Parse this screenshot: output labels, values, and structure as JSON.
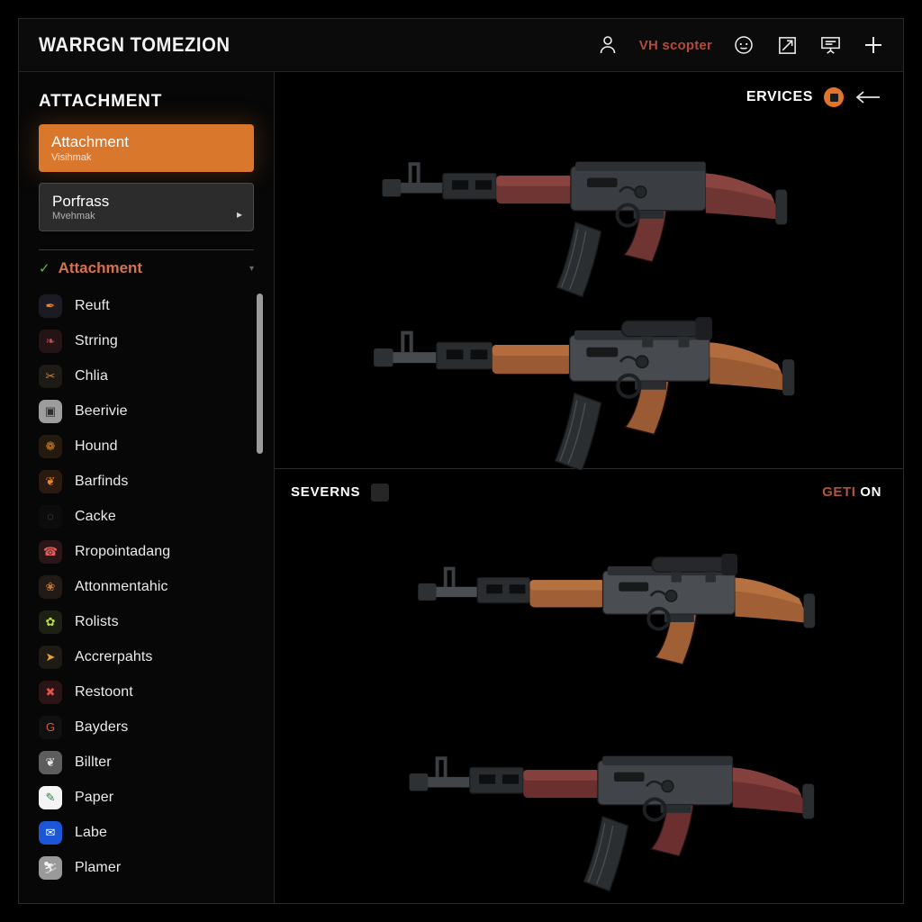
{
  "header": {
    "title": "WARRGN TOMEZION",
    "user_icon": "person-icon",
    "user_tag": "VH scopter",
    "more_icon": "circle-dots-icon",
    "expand_icon": "arrow-expand-icon",
    "board_icon": "presentation-board-icon",
    "add_icon": "plus-icon"
  },
  "sidebar": {
    "title": "ATTACHMENT",
    "primary_card": {
      "title": "Attachment",
      "subtitle": "Visihmak"
    },
    "secondary_card": {
      "title": "Porfrass",
      "subtitle": "Mvehmak",
      "chevron": "▸"
    },
    "section": {
      "check": "✓",
      "label": "Attachment",
      "caret": "▾"
    },
    "items": [
      {
        "label": "Plamer",
        "icon": "plamer-icon",
        "bg": "#9a9a9a",
        "fg": "#f2f2f2",
        "glyph": "⛷"
      },
      {
        "label": "Labe",
        "icon": "labe-icon",
        "bg": "#1a56d6",
        "fg": "#ffffff",
        "glyph": "✉"
      },
      {
        "label": "Paper",
        "icon": "paper-icon",
        "bg": "#f4f4f4",
        "fg": "#3f7a4a",
        "glyph": "✎"
      },
      {
        "label": "Billter",
        "icon": "billter-icon",
        "bg": "#5d5d5d",
        "fg": "#e8e8e8",
        "glyph": "❦"
      },
      {
        "label": "Bayders",
        "icon": "bayders-icon",
        "bg": "#101010",
        "fg": "#e8562f",
        "glyph": "G"
      },
      {
        "label": "Restoont",
        "icon": "restoont-icon",
        "bg": "#2b1416",
        "fg": "#e0534a",
        "glyph": "✖"
      },
      {
        "label": "Accrerpahts",
        "icon": "accrerpahts-icon",
        "bg": "#1f1b14",
        "fg": "#e6a23c",
        "glyph": "➤"
      },
      {
        "label": "Rolists",
        "icon": "rolists-icon",
        "bg": "#1d2014",
        "fg": "#c3d94a",
        "glyph": "✿"
      },
      {
        "label": "Attonmentahic",
        "icon": "attonmentahic-icon",
        "bg": "#221a14",
        "fg": "#c9762f",
        "glyph": "❀"
      },
      {
        "label": "Rropointadang",
        "icon": "rropointadang-icon",
        "bg": "#2a1618",
        "fg": "#d9605c",
        "glyph": "☎"
      },
      {
        "label": "Cacke",
        "icon": "cacke-icon",
        "bg": "#0c0c0c",
        "fg": "#6b6b6b",
        "glyph": "◌"
      },
      {
        "label": "Barfinds",
        "icon": "barfinds-icon",
        "bg": "#2a1a10",
        "fg": "#e7862b",
        "glyph": "❦"
      },
      {
        "label": "Hound",
        "icon": "hound-icon",
        "bg": "#241a10",
        "fg": "#d9862e",
        "glyph": "❁"
      },
      {
        "label": "Beerivie",
        "icon": "beerivie-icon",
        "bg": "#9d9d9d",
        "fg": "#2e2e2e",
        "glyph": "▣"
      },
      {
        "label": "Chlia",
        "icon": "chlia-icon",
        "bg": "#1e1a16",
        "fg": "#c98a45",
        "glyph": "✂"
      },
      {
        "label": "Strring",
        "icon": "strring-icon",
        "bg": "#241416",
        "fg": "#c04a50",
        "glyph": "❧"
      },
      {
        "label": "Reuft",
        "icon": "reuft-icon",
        "bg": "#1c1a22",
        "fg": "#e08a3a",
        "glyph": "✒"
      }
    ],
    "scrollbar": {
      "name": "sidebar-scrollbar"
    }
  },
  "content": {
    "services_label": "ERVICES",
    "services_dot_icon": "orange-status-dot-icon",
    "back_icon": "back-arrow-icon",
    "divider": {
      "label": "SEVERNS",
      "badge": "severns-badge",
      "action_primary": "GETI",
      "action_secondary": "ON"
    },
    "weapons": [
      {
        "name": "weapon-preview-1",
        "wood": "#6e3532",
        "wood2": "#8a4440",
        "metal": "#3a3d41",
        "scope": false,
        "mag": true
      },
      {
        "name": "weapon-preview-2",
        "wood": "#9a5a34",
        "wood2": "#b36c3e",
        "metal": "#474b50",
        "scope": true,
        "mag": true
      },
      {
        "name": "weapon-preview-3",
        "wood": "#a05f35",
        "wood2": "#b5713f",
        "metal": "#4a4e53",
        "scope": true,
        "mag": false
      },
      {
        "name": "weapon-preview-4",
        "wood": "#6b2f30",
        "wood2": "#84403d",
        "metal": "#41454a",
        "scope": false,
        "mag": true
      }
    ]
  },
  "colors": {
    "accent_orange": "#d9772d",
    "accent_red": "#b34a3c",
    "check_green": "#63b843",
    "section_salmon": "#d4724f",
    "background": "#000000"
  }
}
